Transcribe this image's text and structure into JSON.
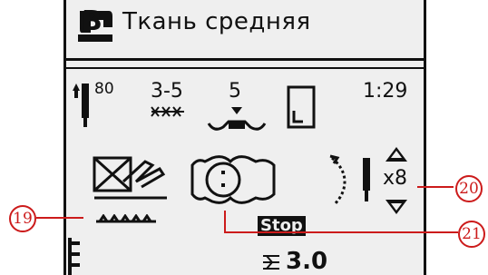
{
  "header": {
    "mode_letter": "B",
    "fabric_title": "Ткань средняя"
  },
  "settings": {
    "needle_size": "80",
    "tension_range": "3-5",
    "presser_pressure": "5",
    "stitch_time": "1:29"
  },
  "repeat": {
    "count": "x8"
  },
  "stop": {
    "label": "Stop"
  },
  "stitch_width": {
    "value": "3.0"
  },
  "callouts": {
    "c19": "19",
    "c20": "20",
    "c21": "21"
  },
  "colors": {
    "callout": "#cc1b1b",
    "lcd_bg": "#efefef",
    "ink": "#111111"
  }
}
